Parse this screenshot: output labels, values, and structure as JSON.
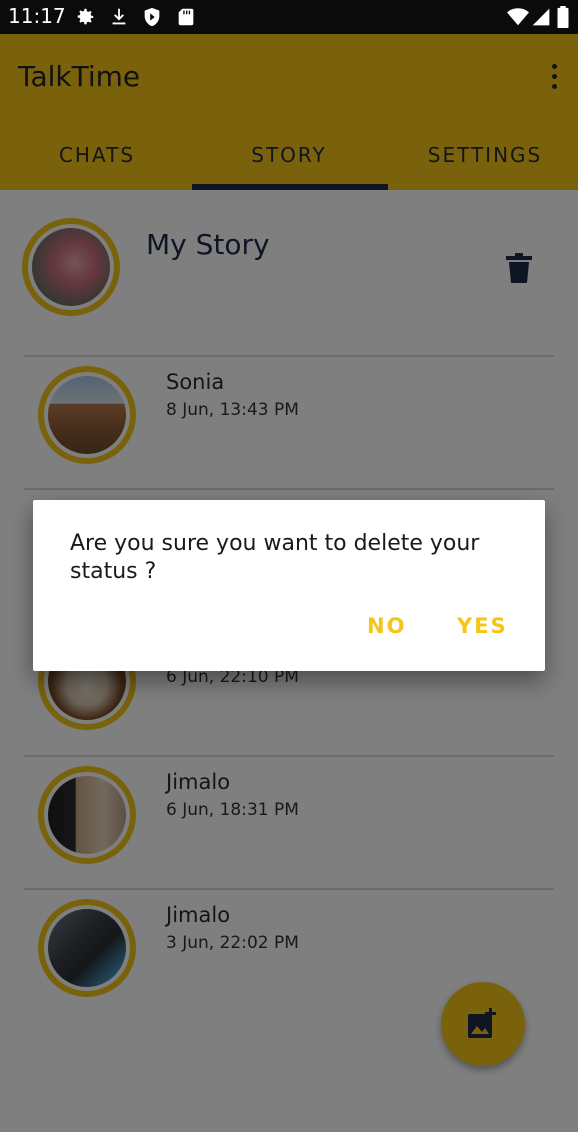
{
  "status_bar": {
    "time": "11:17",
    "left_icons": [
      "settings-icon",
      "download-icon",
      "shield-play-icon",
      "sd-card-icon"
    ],
    "right_icons": [
      "wifi-icon",
      "signal-icon",
      "battery-icon"
    ]
  },
  "app_bar": {
    "title": "TalkTime",
    "menu_icon": "more-vert-icon"
  },
  "tabs": [
    {
      "label": "CHATS",
      "active": false
    },
    {
      "label": "STORY",
      "active": true
    },
    {
      "label": "SETTINGS",
      "active": false
    }
  ],
  "my_story": {
    "name": "My Story",
    "delete_icon": "trash-icon"
  },
  "stories": [
    {
      "name": "Sonia",
      "time": "8 Jun, 13:43 PM"
    },
    {
      "name": "",
      "time": "6 Jun, 22:10 PM"
    },
    {
      "name": "Jimalo",
      "time": "6 Jun, 18:31 PM"
    },
    {
      "name": "Jimalo",
      "time": "3 Jun, 22:02 PM"
    }
  ],
  "fab": {
    "icon": "add-photo-icon"
  },
  "dialog": {
    "message": "Are you sure you want to delete your status ?",
    "no_label": "NO",
    "yes_label": "YES"
  },
  "colors": {
    "accent": "#f5c518",
    "primary_dark": "#1e2a47"
  }
}
